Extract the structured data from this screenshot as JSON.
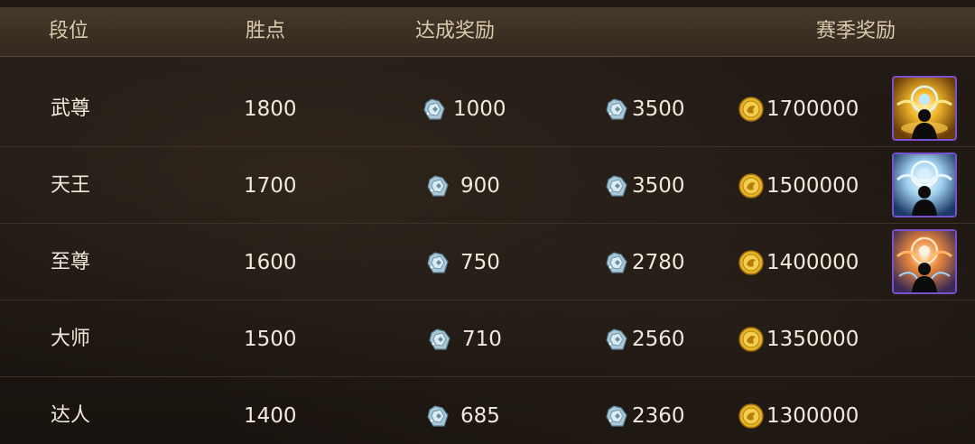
{
  "header": {
    "tier": "段位",
    "points": "胜点",
    "reach_reward": "达成奖励",
    "season_reward": "赛季奖励"
  },
  "rows": [
    {
      "tier": "武尊",
      "points": "1800",
      "reach_gems": "1000",
      "season_gems": "3500",
      "season_coins": "1700000",
      "frame": "gold-frame-avatar"
    },
    {
      "tier": "天王",
      "points": "1700",
      "reach_gems": "900",
      "season_gems": "3500",
      "season_coins": "1500000",
      "frame": "silver-frame-avatar"
    },
    {
      "tier": "至尊",
      "points": "1600",
      "reach_gems": "750",
      "season_gems": "2780",
      "season_coins": "1400000",
      "frame": "bronze-frame-avatar"
    },
    {
      "tier": "大师",
      "points": "1500",
      "reach_gems": "710",
      "season_gems": "2560",
      "season_coins": "1350000"
    },
    {
      "tier": "达人",
      "points": "1400",
      "reach_gems": "685",
      "season_gems": "2360",
      "season_coins": "1300000"
    }
  ],
  "icons": {
    "gem": "diamond-gem-icon",
    "coin": "gold-coin-icon"
  },
  "colors": {
    "header_bg": "#3b3124",
    "header_text": "#d9c9ad",
    "row_text": "#f1e9dc",
    "avatar_border": "#7a4fd0",
    "gold": "#e6b32a",
    "gem": "#a9c8d8"
  }
}
